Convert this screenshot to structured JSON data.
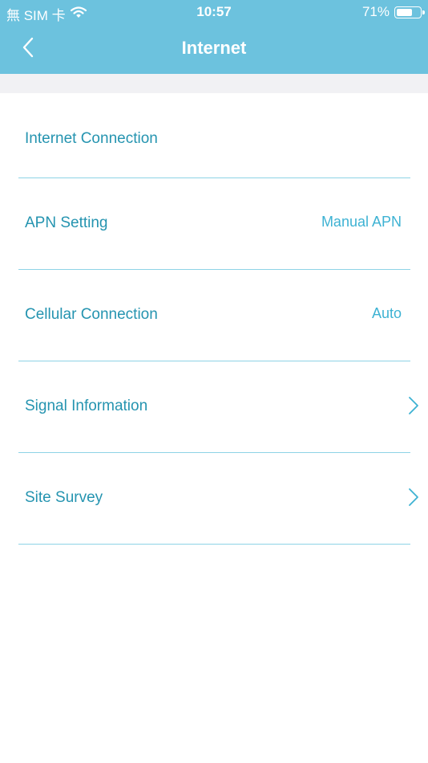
{
  "status_bar": {
    "carrier": "無 SIM 卡",
    "time": "10:57",
    "battery_percent": "71%",
    "battery_level": 0.71
  },
  "nav": {
    "title": "Internet"
  },
  "menu": {
    "items": [
      {
        "label": "Internet Connection",
        "value": ""
      },
      {
        "label": "APN Setting",
        "value": "Manual APN"
      },
      {
        "label": "Cellular Connection",
        "value": "Auto"
      },
      {
        "label": "Signal Information",
        "value": ""
      },
      {
        "label": "Site Survey",
        "value": ""
      }
    ]
  },
  "colors": {
    "header_bg": "#6cc2de",
    "label_text": "#2594b0",
    "value_text": "#3db2d3",
    "divider": "#8ed3e6",
    "band_bg": "#f1f1f4"
  },
  "icons": {
    "back": "chevron-left-icon",
    "row_arrow": "chevron-right-icon",
    "wifi": "wifi-icon",
    "battery": "battery-icon"
  }
}
